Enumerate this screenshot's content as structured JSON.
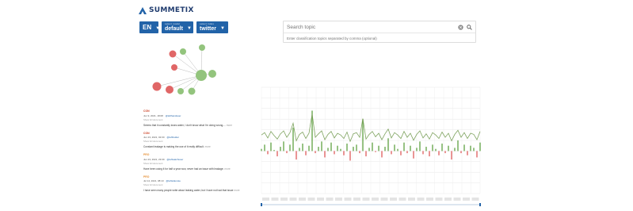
{
  "brand": {
    "name": "SUMMETIX"
  },
  "selectors": [
    {
      "caption": "",
      "value": "EN"
    },
    {
      "caption": "select model",
      "value": "default"
    },
    {
      "caption": "select index",
      "value": "twitter"
    }
  ],
  "search": {
    "placeholder": "Search topic",
    "topics_placeholder": "Enter classification topics separated by comma (optional)"
  },
  "feed": [
    {
      "sentiment": "CON",
      "date": "Jun 9, 2021, 18:08",
      "handle": "@lefthanduser",
      "show": "Show full document",
      "text": "Seems that it constantly loses water, I don't know what I'm doing wrong....",
      "more": "more"
    },
    {
      "sentiment": "CON",
      "date": "Jun 23, 2021, 02:00",
      "handle": "@leftholder",
      "show": "Show full document",
      "text": "Constant leakage is making the use of it really difficult.",
      "more": "more"
    },
    {
      "sentiment": "PRO",
      "date": "Jun 23, 2021, 23:09",
      "handle": "@leftwatchuser",
      "show": "Show full document",
      "text": "Have been using it for half a year now, never had an issue with leakage.",
      "more": "more"
    },
    {
      "sentiment": "PRO",
      "date": "Jul 14, 2021, 08:10",
      "handle": "@leftsidenote",
      "show": "Show full document",
      "text": "I have seen many people write about leaking water, but I have not had that issue",
      "more": "more"
    }
  ],
  "colors": {
    "brand": "#1f3b6e",
    "accent": "#2263a8",
    "pro": "#6aa84f",
    "con": "#e06666",
    "con_text": "#cc4125",
    "pro_text": "#e69138",
    "line": "#7ea35f"
  },
  "chart_data": {
    "type": "line",
    "x": [
      1,
      2,
      3,
      4,
      5,
      6,
      7,
      8,
      9,
      10,
      11,
      12,
      13,
      14,
      15,
      16,
      17,
      18,
      19,
      20,
      21,
      22,
      23,
      24,
      25,
      26,
      27,
      28,
      29,
      30,
      31,
      32,
      33,
      34,
      35,
      36,
      37,
      38,
      39,
      40,
      41,
      42,
      43,
      44,
      45,
      46,
      47,
      48,
      49,
      50,
      51,
      52,
      53,
      54,
      55,
      56,
      57,
      58,
      59,
      60,
      61,
      62,
      63,
      64,
      65,
      66,
      67,
      68,
      69,
      70
    ],
    "series": [
      {
        "values": [
          2,
          6,
          -3,
          8,
          1,
          -5,
          4,
          9,
          -2,
          6,
          22,
          -8,
          3,
          7,
          -4,
          5,
          38,
          -2,
          4,
          9,
          -6,
          3,
          8,
          -3,
          5,
          2,
          -4,
          7,
          -9,
          4,
          6,
          -2,
          30,
          -5,
          3,
          8,
          -1,
          5,
          -6,
          4,
          12,
          -3,
          6,
          2,
          -4,
          8,
          -2,
          5,
          -7,
          3,
          9,
          -3,
          4,
          -5,
          6,
          2,
          -4,
          7,
          -2,
          5,
          -8,
          3,
          10,
          -2,
          6,
          -4,
          5,
          3,
          -6,
          8
        ]
      }
    ]
  }
}
